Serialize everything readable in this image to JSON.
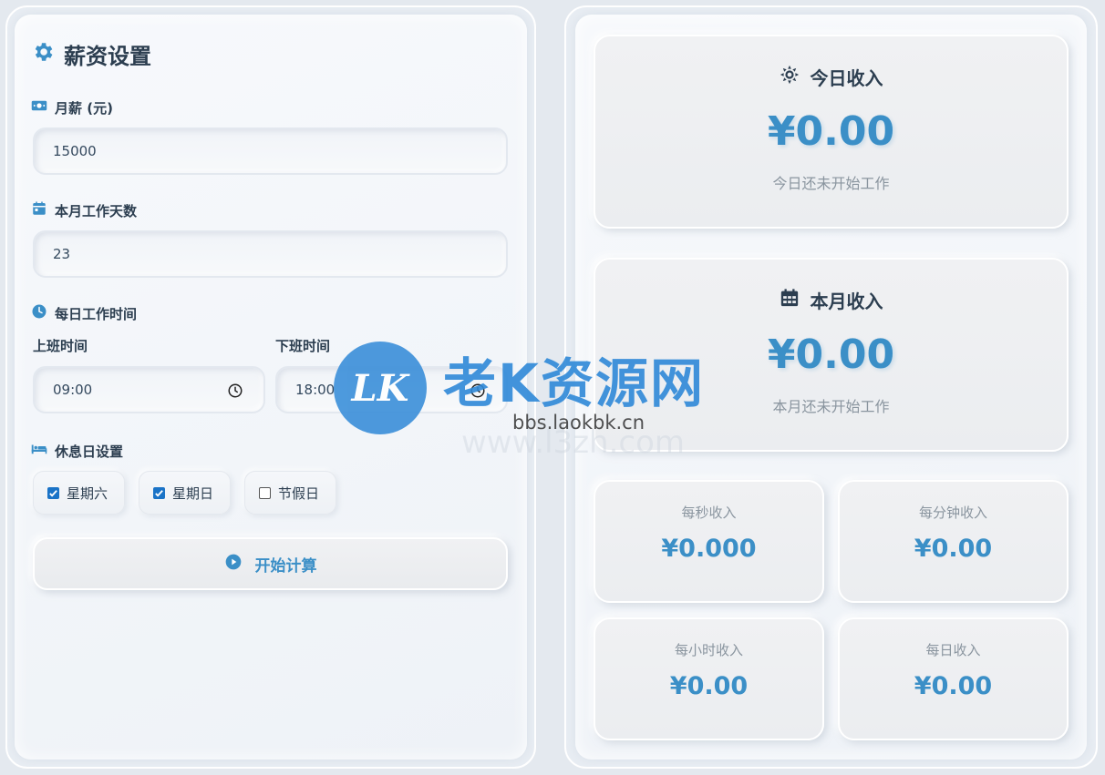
{
  "settings": {
    "title": "薪资设置",
    "salary_label": "月薪 (元)",
    "salary_value": "15000",
    "workdays_label": "本月工作天数",
    "workdays_value": "23",
    "worktime_label": "每日工作时间",
    "start_label": "上班时间",
    "start_value": "09:00",
    "end_label": "下班时间",
    "end_value": "18:00",
    "rest_label": "休息日设置",
    "rest_days": [
      {
        "label": "星期六",
        "checked": true
      },
      {
        "label": "星期日",
        "checked": true
      },
      {
        "label": "节假日",
        "checked": false
      }
    ],
    "start_button": "开始计算"
  },
  "income": {
    "today": {
      "title": "今日收入",
      "value": "¥0.00",
      "note": "今日还未开始工作"
    },
    "month": {
      "title": "本月收入",
      "value": "¥0.00",
      "note": "本月还未开始工作"
    },
    "per_second": {
      "label": "每秒收入",
      "value": "¥0.000"
    },
    "per_minute": {
      "label": "每分钟收入",
      "value": "¥0.00"
    },
    "per_hour": {
      "label": "每小时收入",
      "value": "¥0.00"
    },
    "per_day": {
      "label": "每日收入",
      "value": "¥0.00"
    }
  },
  "watermark": {
    "logo_text": "LK",
    "site_name": "老K资源网",
    "url": "bbs.laokbk.cn",
    "faint_url": "www.l3zh.com"
  },
  "colors": {
    "accent": "#3b8fc7",
    "text": "#2c3e50",
    "muted": "#8a959f",
    "checkbox": "#1a73c7"
  },
  "icons": {
    "title": "gear-icon",
    "salary": "money-bill-icon",
    "workdays": "calendar-icon",
    "worktime": "clock-icon",
    "rest": "bed-icon",
    "start": "play-circle-icon",
    "today": "sun-icon",
    "month": "calendar-grid-icon"
  }
}
